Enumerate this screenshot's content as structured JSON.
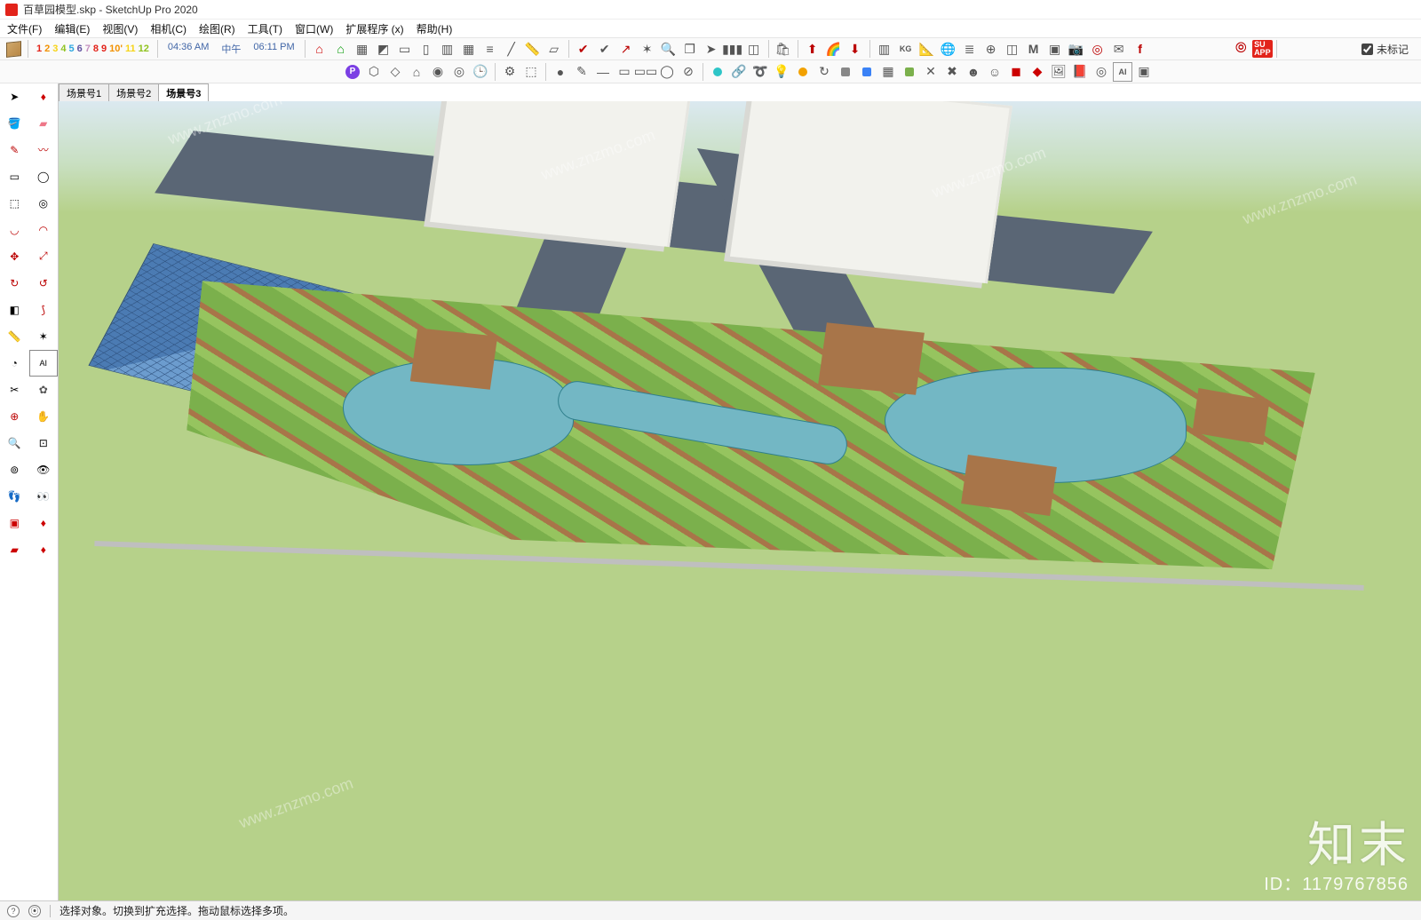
{
  "title_prefix": "百草园模型.skp - SketchUp Pro 2020",
  "menus": [
    "文件(F)",
    "编辑(E)",
    "视图(V)",
    "相机(C)",
    "绘图(R)",
    "工具(T)",
    "窗口(W)",
    "扩展程序 (x)",
    "帮助(H)"
  ],
  "numbers": [
    "1",
    "2",
    "3",
    "4",
    "5",
    "6",
    "7",
    "8",
    "9",
    "10'",
    "11",
    "12"
  ],
  "time_left": "04:36 AM",
  "time_mid": "中午",
  "time_right": "06:11 PM",
  "tag_label": "未标记",
  "scene_tabs": [
    "场景号1",
    "场景号2",
    "场景号3"
  ],
  "active_scene_index": 2,
  "status_icons": {
    "help": "?",
    "person": "⦿"
  },
  "status_text": "选择对象。切换到扩充选择。拖动鼠标选择多项。",
  "watermark_logo": "知末",
  "watermark_id": "ID：1179767856",
  "watermark_url": "www.znzmo.com"
}
